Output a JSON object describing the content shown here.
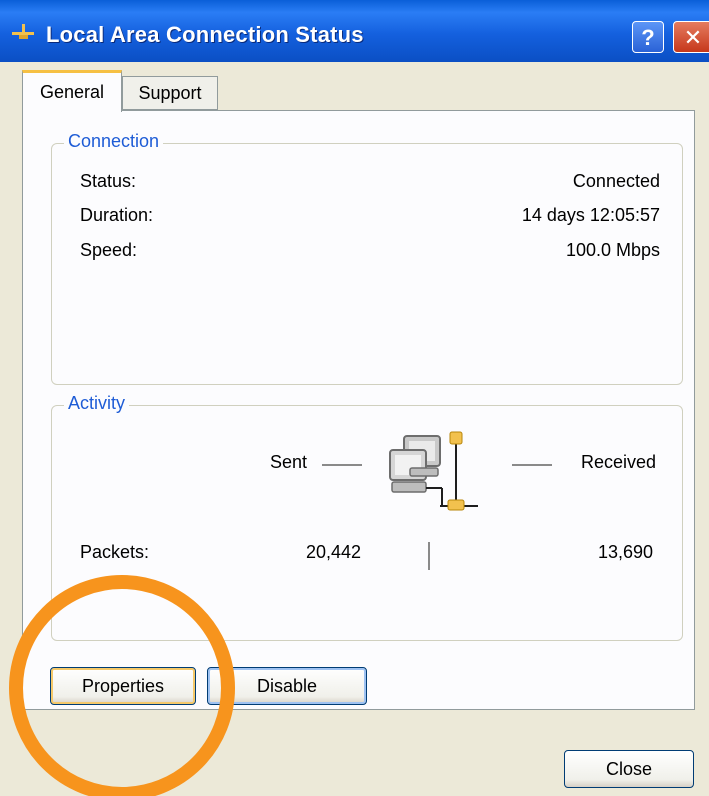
{
  "window": {
    "title": "Local Area Connection Status",
    "help_label": "?",
    "close_glyph": "✕"
  },
  "tabs": [
    {
      "label": "General",
      "selected": true
    },
    {
      "label": "Support",
      "selected": false
    }
  ],
  "connection": {
    "legend": "Connection",
    "rows": [
      {
        "label": "Status:",
        "value": "Connected"
      },
      {
        "label": "Duration:",
        "value": "14 days 12:05:57"
      },
      {
        "label": "Speed:",
        "value": "100.0 Mbps"
      }
    ]
  },
  "activity": {
    "legend": "Activity",
    "sent_label": "Sent",
    "received_label": "Received",
    "packets_label": "Packets:",
    "packets_sent": "20,442",
    "packets_received": "13,690",
    "icon": "network-computers-icon"
  },
  "buttons": {
    "properties": "Properties",
    "disable": "Disable",
    "close": "Close"
  },
  "colors": {
    "titlebar": "#0b4fc4",
    "legend": "#1e5cd6",
    "highlight_circle": "#f7941d"
  }
}
